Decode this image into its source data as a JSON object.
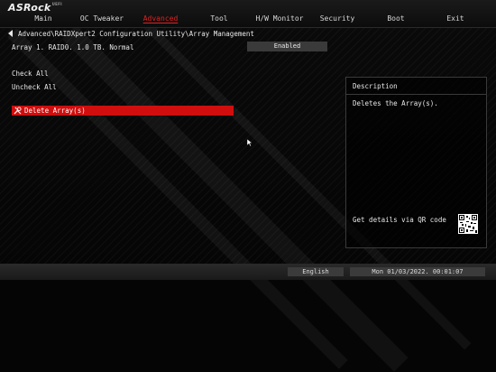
{
  "brand": {
    "name": "ASRock",
    "sub": "UEFI"
  },
  "tabs": [
    {
      "label": "Main"
    },
    {
      "label": "OC Tweaker"
    },
    {
      "label": "Advanced",
      "active": true
    },
    {
      "label": "Tool"
    },
    {
      "label": "H/W Monitor"
    },
    {
      "label": "Security"
    },
    {
      "label": "Boot"
    },
    {
      "label": "Exit"
    }
  ],
  "breadcrumb": "Advanced\\RAIDXpert2 Configuration Utility\\Array Management",
  "settings": [
    {
      "label": "Array 1. RAID0. 1.0 TB. Normal",
      "value": "Enabled"
    }
  ],
  "menu": [
    {
      "label": "Check All"
    },
    {
      "label": "Uncheck All"
    },
    {
      "label": "Delete Array(s)",
      "selected": true,
      "icon": "wrench-screwdriver-icon"
    }
  ],
  "description": {
    "title": "Description",
    "text": "Deletes the Array(s).",
    "qr_text": "Get details via QR code"
  },
  "status": {
    "language": "English",
    "datetime": "Mon 01/03/2022. 00:01:07"
  },
  "colors": {
    "accent": "#d00e0e",
    "tab_active": "#e02020"
  }
}
